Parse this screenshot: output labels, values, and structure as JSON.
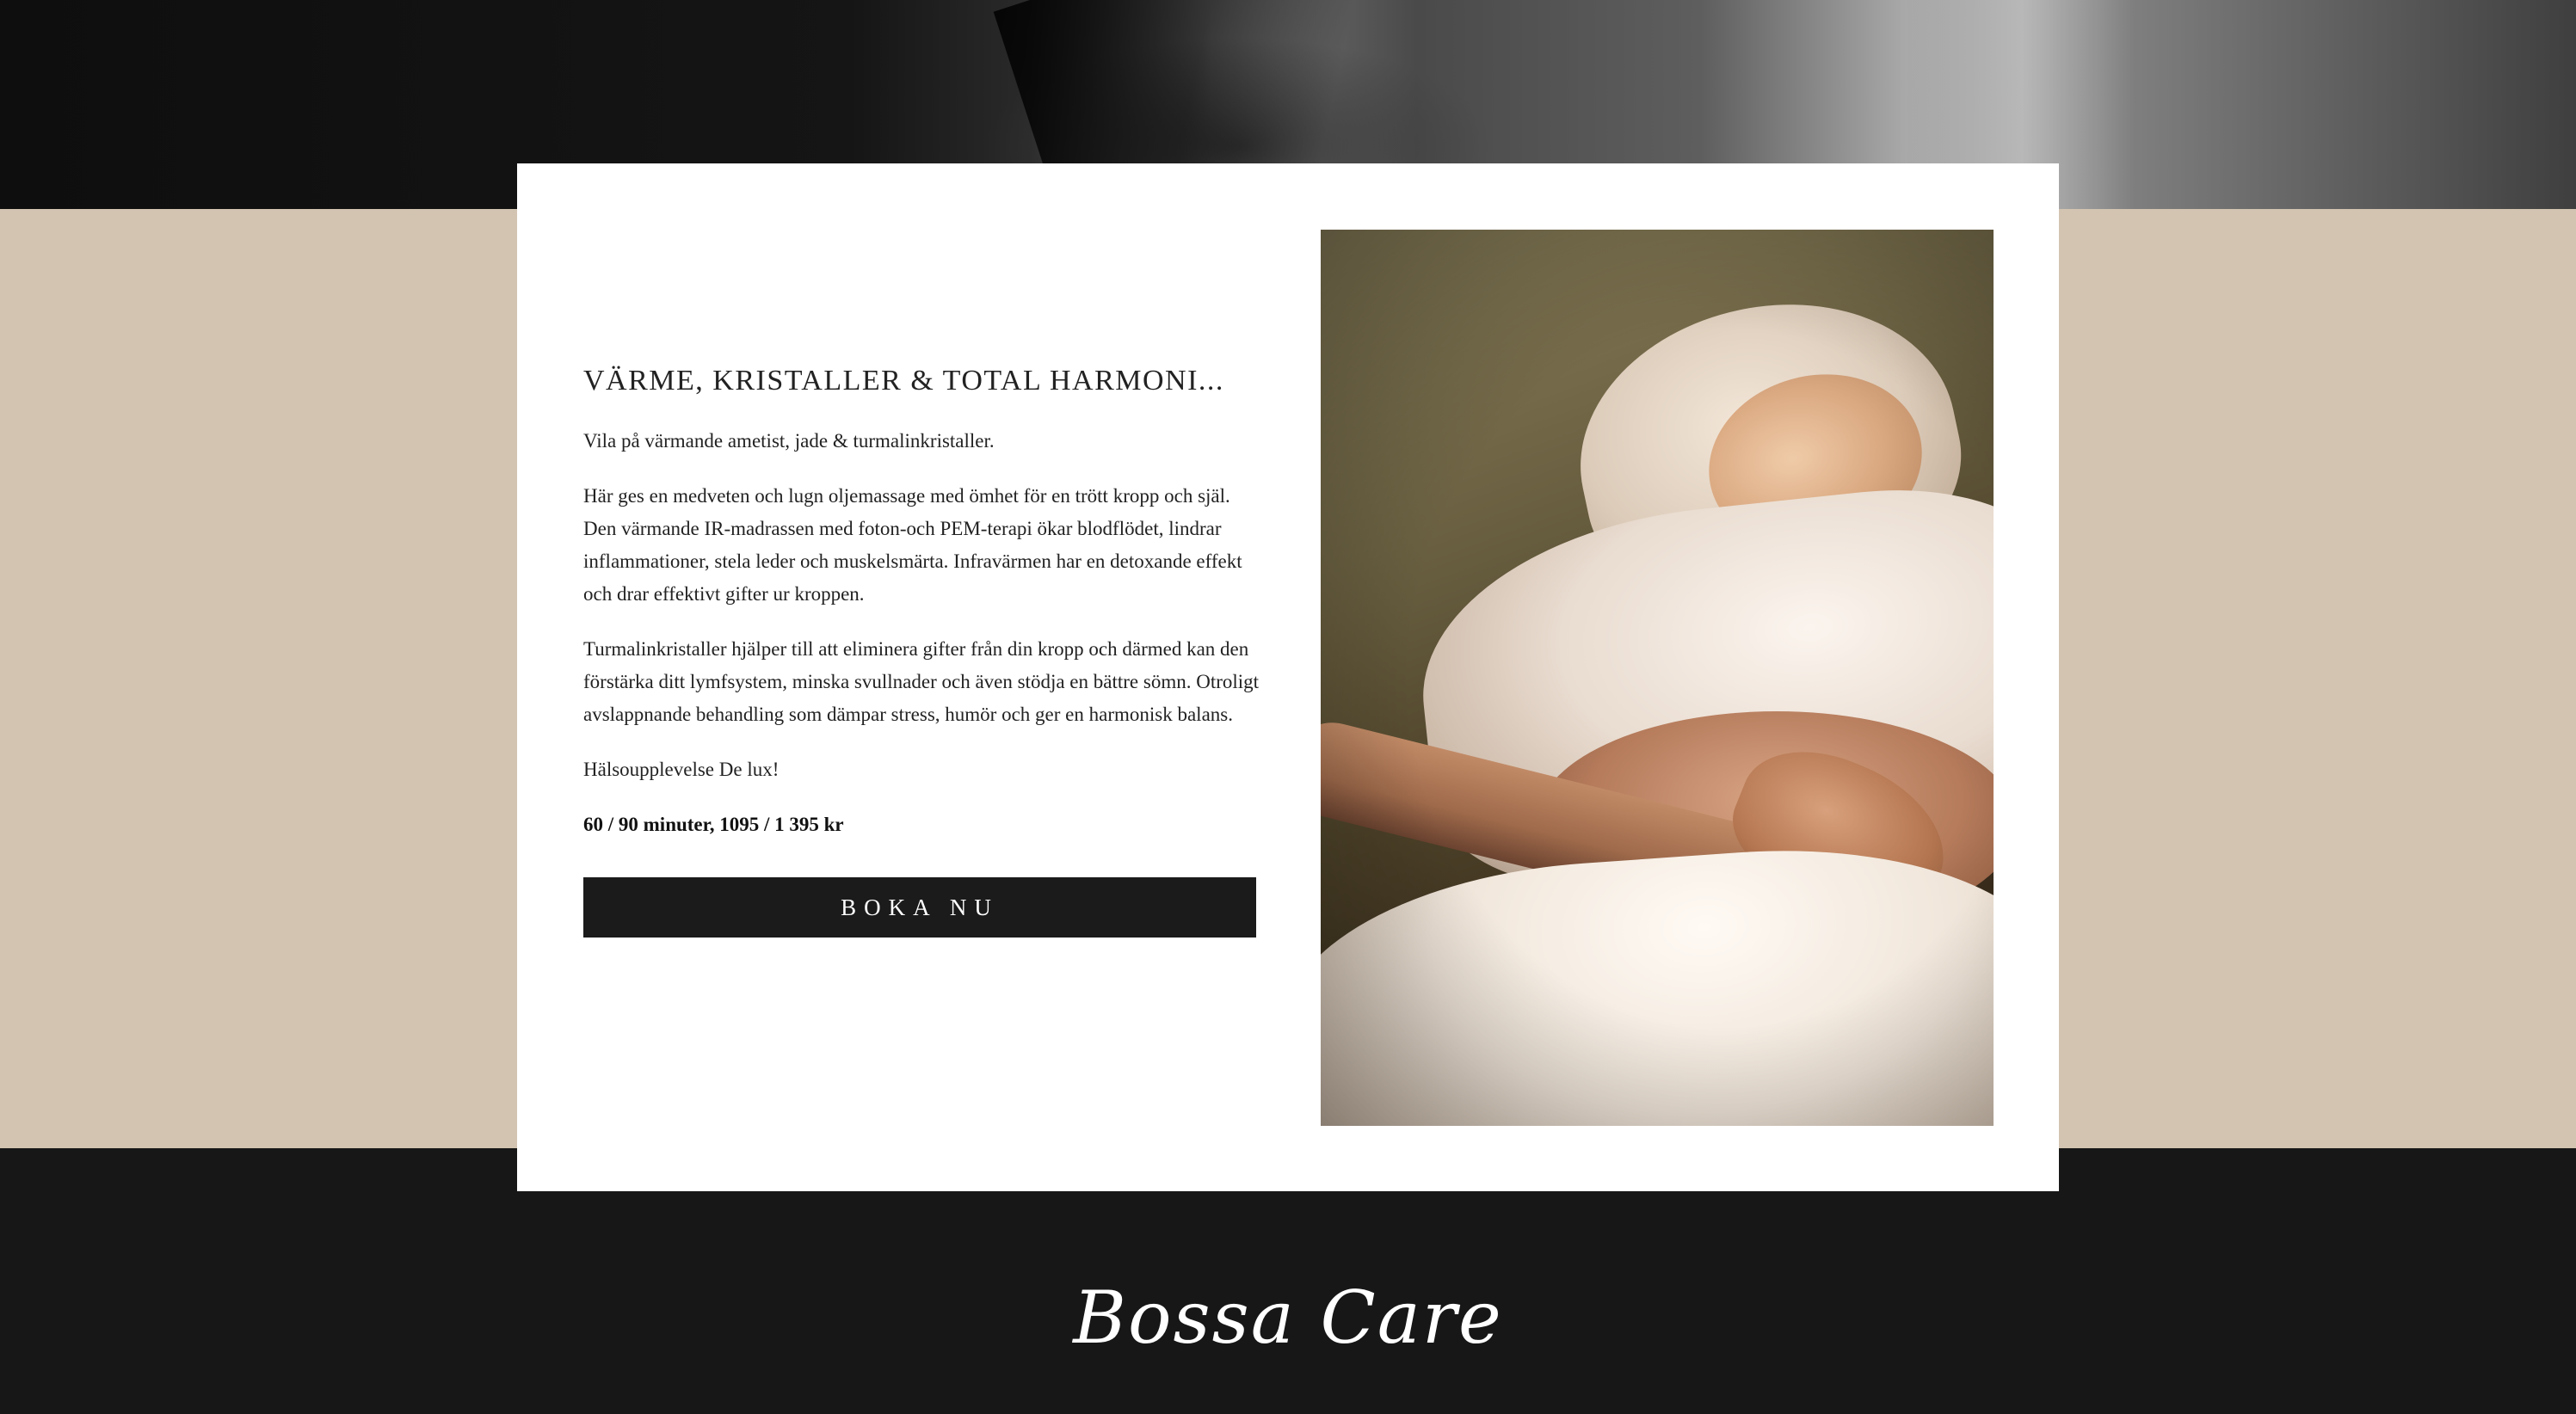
{
  "service": {
    "heading": "VÄRME, KRISTALLER & TOTAL HARMONI...",
    "paragraphs": [
      "Vila på värmande ametist, jade & turmalinkristaller.",
      "Här ges en medveten och lugn oljemassage med ömhet för en trött kropp och själ. Den värmande IR-madrassen med foton-och PEM-terapi ökar blodflödet, lindrar inflammationer, stela leder och muskelsmärta. Infravärmen har en detoxande effekt och drar effektivt gifter ur kroppen.",
      "Turmalinkristaller hjälper till att eliminera gifter från din kropp och därmed kan den förstärka ditt lymfsystem, minska svullnader och även stödja en bättre sömn. Otroligt avslappnande behandling som dämpar stress, humör och ger en harmonisk balans.",
      "Hälsoupplevelse De lux!"
    ],
    "price": "60 / 90 minuter, 1095 / 1 395 kr",
    "book_label": "BOKA NU"
  },
  "footer": {
    "brand": "Bossa Care"
  },
  "colors": {
    "beige_band": "#d2c4b0",
    "footer": "#171717",
    "button": "#1b1b1b",
    "card": "#ffffff"
  }
}
